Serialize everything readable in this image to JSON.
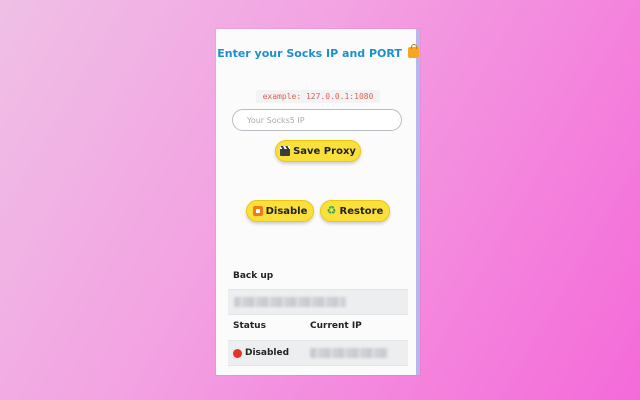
{
  "heading": {
    "text": "Enter your Socks IP and PORT",
    "icon": "fuel-pump-icon"
  },
  "example_hint": "example: 127.0.0.1:1080",
  "ip_input": {
    "placeholder": "Your Socks5 IP",
    "value": ""
  },
  "buttons": {
    "save": {
      "label": "Save Proxy",
      "icon": "clapper-board-icon"
    },
    "disable": {
      "label": "Disable",
      "icon": "stop-button-icon"
    },
    "restore": {
      "label": "Restore",
      "icon": "recycle-icon"
    }
  },
  "backup": {
    "label": "Back up"
  },
  "table": {
    "status_header": "Status",
    "current_ip_header": "Current IP",
    "status_value": "Disabled",
    "status_color": "#e2322a"
  },
  "colors": {
    "accent": "#1d8fcf",
    "button": "#fbe03c"
  }
}
